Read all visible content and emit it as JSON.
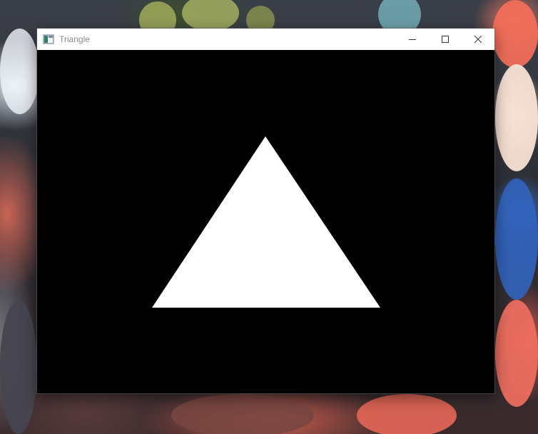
{
  "window": {
    "title": "Triangle",
    "icon": "app-window-icon",
    "controls": {
      "minimize_icon": "minimize-icon",
      "maximize_icon": "maximize-icon",
      "close_icon": "close-icon"
    }
  },
  "canvas": {
    "background_color": "#000000",
    "shape": "triangle",
    "shape_color": "#ffffff"
  },
  "desktop": {
    "wallpaper": "anime-artwork"
  }
}
